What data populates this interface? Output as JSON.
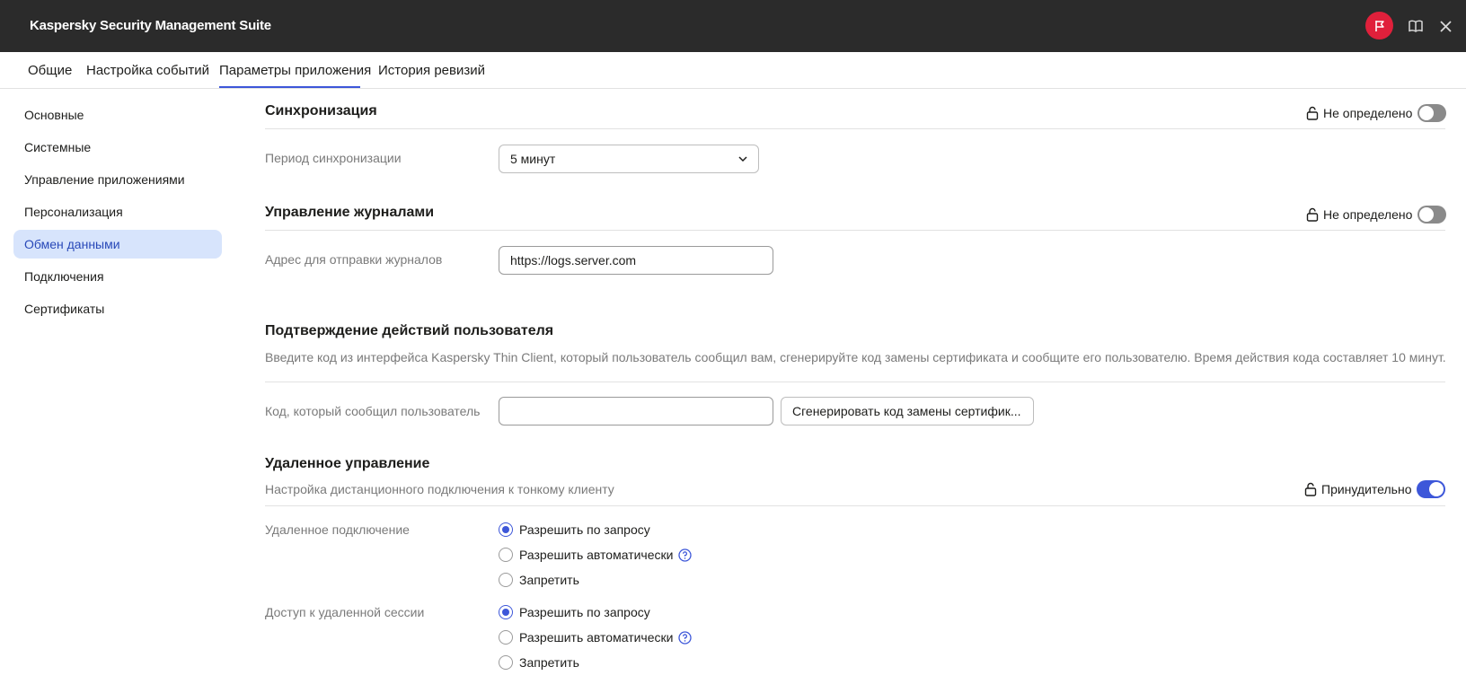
{
  "window": {
    "title": "Kaspersky Security Management Suite"
  },
  "tabs": [
    {
      "label": "Общие"
    },
    {
      "label": "Настройка событий"
    },
    {
      "label": "Параметры приложения"
    },
    {
      "label": "История ревизий"
    }
  ],
  "active_tab": "Параметры приложения",
  "sidebar": {
    "items": [
      {
        "label": "Основные"
      },
      {
        "label": "Системные"
      },
      {
        "label": "Управление приложениями"
      },
      {
        "label": "Персонализация"
      },
      {
        "label": "Обмен данными"
      },
      {
        "label": "Подключения"
      },
      {
        "label": "Сертификаты"
      }
    ],
    "active_item": "Обмен данными"
  },
  "sync": {
    "title": "Синхронизация",
    "lock_status": "Не определено",
    "toggle_on": false,
    "period_label": "Период синхронизации",
    "period_value": "5 минут"
  },
  "logs": {
    "title": "Управление журналами",
    "lock_status": "Не определено",
    "toggle_on": false,
    "address_label": "Адрес для отправки журналов",
    "address_value": "https://logs.server.com"
  },
  "confirm": {
    "title": "Подтверждение действий пользователя",
    "description": "Введите код из интерфейса Kaspersky Thin Client, который пользователь сообщил вам, сгенерируйте код замены сертификата и сообщите его пользователю. Время действия кода составляет 10 минут.",
    "code_label": "Код, который сообщил пользователь",
    "code_value": "",
    "generate_button": "Сгенерировать код замены сертифик..."
  },
  "remote": {
    "title": "Удаленное управление",
    "description": "Настройка дистанционного подключения к тонкому клиенту",
    "lock_status": "Принудительно",
    "toggle_on": true,
    "connection_label": "Удаленное подключение",
    "connection_options": [
      {
        "label": "Разрешить по запросу",
        "checked": true
      },
      {
        "label": "Разрешить автоматически",
        "checked": false,
        "help": true
      },
      {
        "label": "Запретить",
        "checked": false
      }
    ],
    "session_label": "Доступ к удаленной сессии",
    "session_options": [
      {
        "label": "Разрешить по запросу",
        "checked": true
      },
      {
        "label": "Разрешить автоматически",
        "checked": false,
        "help": true
      },
      {
        "label": "Запретить",
        "checked": false
      }
    ]
  },
  "colors": {
    "titlebar": "#2b2b2b",
    "accent": "#3d57d9",
    "flag_button": "#e0203b",
    "sidebar_active_bg": "#d7e4fc"
  },
  "icons": {
    "flag": "flag-icon",
    "book": "book-icon",
    "close": "close-icon",
    "lock": "lock-icon",
    "chevron": "chevron-down-icon",
    "help": "help-icon"
  }
}
